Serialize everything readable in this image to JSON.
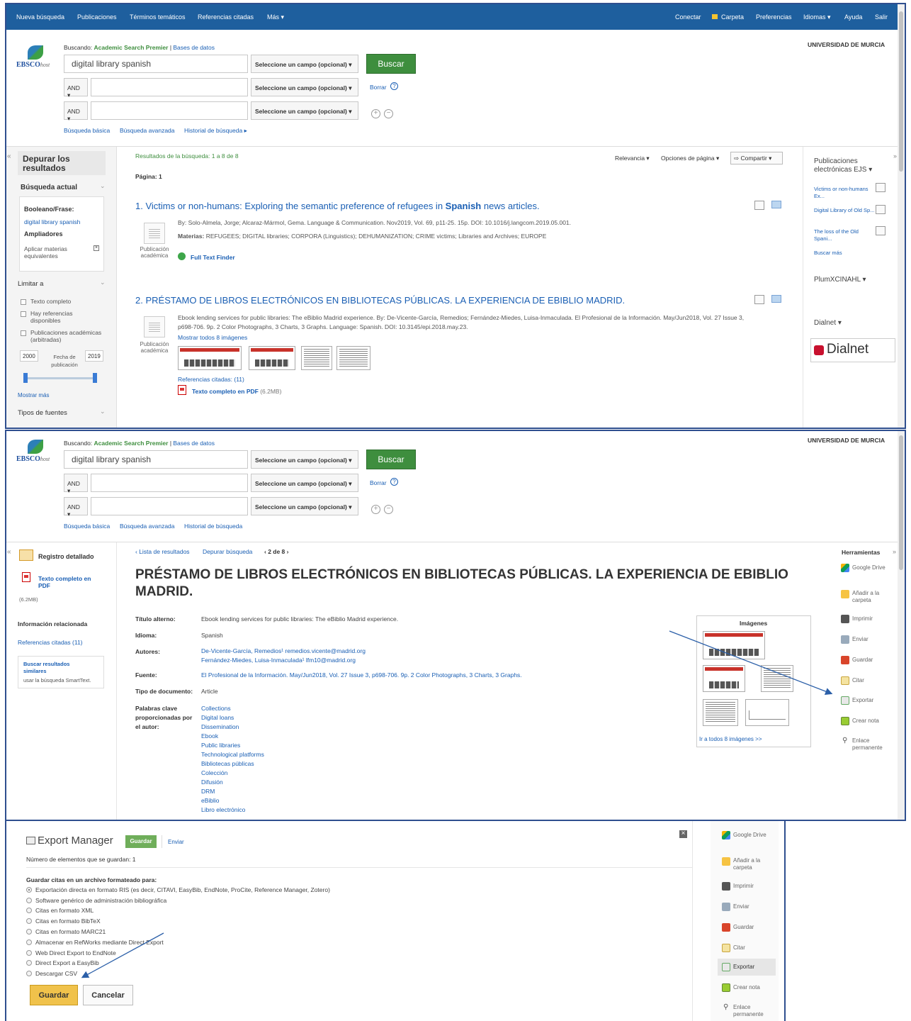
{
  "topnav": {
    "left": [
      "Nueva búsqueda",
      "Publicaciones",
      "Términos temáticos",
      "Referencias citadas",
      "Más ▾"
    ],
    "right": [
      "Conectar",
      "Carpeta",
      "Preferencias",
      "Idiomas ▾",
      "Ayuda",
      "Salir"
    ]
  },
  "header": {
    "institution": "UNIVERSIDAD DE MURCIA",
    "logo_main": "EBSCO",
    "logo_sub": "host",
    "searching_label": "Buscando:",
    "database": "Academic Search Premier",
    "databases_link": "Bases de datos",
    "query": "digital library spanish",
    "field_select": "Seleccione un campo (opcional) ▾",
    "bool_op": "AND ▾",
    "search_button": "Buscar",
    "clear_link": "Borrar",
    "help": "?",
    "add": "+",
    "remove": "−",
    "links": [
      "Búsqueda básica",
      "Búsqueda avanzada",
      "Historial de búsqueda ▸"
    ],
    "links2": [
      "Búsqueda básica",
      "Búsqueda avanzada",
      "Historial de búsqueda"
    ]
  },
  "panel1": {
    "refine_title": "Depurar los resultados",
    "current_search": "Búsqueda actual",
    "boolean_label": "Booleano/Frase:",
    "boolean_value": "digital library spanish",
    "expanders_label": "Ampliadores",
    "expanders_value": "Aplicar materias equivalentes",
    "limit_to": "Limitar a",
    "limit_options": [
      "Texto completo",
      "Hay referencias disponibles",
      "Publicaciones académicas (arbitradas)"
    ],
    "date_from": "2000",
    "date_label": "Fecha de publicación",
    "date_to": "2019",
    "show_more": "Mostrar más",
    "source_types": "Tipos de fuentes",
    "results_label": "Resultados de la búsqueda: 1 a 8 de 8",
    "page_label": "Página: 1",
    "sort": "Relevancia ▾",
    "page_options": "Opciones de página ▾",
    "share": "Compartir ▾",
    "pub_type": "Publicación académica",
    "r1_num": "1.",
    "r1_title_a": "Victims or non-humans: Exploring the semantic preference of refugees in ",
    "r1_title_b": "Spanish",
    "r1_title_c": " news articles.",
    "r1_byline": "By: Solo-Almela, Jorge; Alcaraz-Mármol, Gema. Language & Communication. Nov2019, Vol. 69, p11-25. 15p. DOI: 10.1016/j.langcom.2019.05.001.",
    "r1_subjects_label": "Materias:",
    "r1_subjects": "REFUGEES; DIGITAL libraries; CORPORA (Linguistics); DEHUMANIZATION; CRIME victims; Libraries and Archives; EUROPE",
    "r1_fulltext": "Full Text Finder",
    "r2_num": "2.",
    "r2_title": "PRÉSTAMO DE LIBROS ELECTRÓNICOS EN BIBLIOTECAS PÚBLICAS. LA EXPERIENCIA DE EBIBLIO MADRID.",
    "r2_line1": "Ebook lending services for public libraries: The eBiblio Madrid experience. By: De-Vicente-García, Remedios; Fernández-Miedes, Luisa-Inmaculada. El Profesional de la Información. May/Jun2018, Vol. 27 Issue 3,",
    "r2_line2": "p698-706. 9p. 2 Color Photographs, 3 Charts, 3 Graphs. Language: Spanish. DOI: 10.3145/epi.2018.may.23.",
    "r2_show_images": "Mostrar todos 8 imágenes",
    "r2_cited": "Referencias citadas: (11)",
    "r2_pdf": "Texto completo en PDF",
    "r2_pdf_size": "(6.2MB)",
    "right_pub": "Publicaciones electrónicas EJS ▾",
    "right_items": [
      "Victims or non-humans Ex...",
      "Digital Library of Old Sp...",
      "The loss of the Old Spani..."
    ],
    "right_more": "Buscar más",
    "plum": "PlumXCINAHL ▾",
    "dialnet_label": "Dialnet ▾",
    "dialnet_logo": "Dialnet"
  },
  "panel2": {
    "detail_record": "Registro detallado",
    "fulltext_pdf": "Texto completo en PDF",
    "pdf_size": "(6.2MB)",
    "related_info": "Información relacionada",
    "cited_refs": "Referencias citadas (11)",
    "similar_title": "Buscar resultados similares",
    "similar_sub": "usar la búsqueda SmartText.",
    "nav_results": "‹ Lista de resultados",
    "nav_refine": "Depurar búsqueda",
    "nav_pos": "‹ 2 de 8 ›",
    "title": "PRÉSTAMO DE LIBROS ELECTRÓNICOS EN BIBLIOTECAS PÚBLICAS. LA EXPERIENCIA DE EBIBLIO MADRID.",
    "fields": {
      "alt_title_label": "Título alterno:",
      "alt_title": "Ebook lending services for public libraries: The eBiblio Madrid experience.",
      "lang_label": "Idioma:",
      "lang": "Spanish",
      "authors_label": "Autores:",
      "author1": "De-Vicente-García, Remedios¹ remedios.vicente@madrid.org",
      "author2": "Fernández-Miedes, Luisa-Inmaculada¹ lfm10@madrid.org",
      "source_label": "Fuente:",
      "source": "El Profesional de la Información. May/Jun2018, Vol. 27 Issue 3, p698-706. 9p. 2 Color Photographs, 3 Charts, 3 Graphs.",
      "doctype_label": "Tipo de documento:",
      "doctype": "Article",
      "keywords_label": "Palabras clave proporcionadas por el autor:",
      "keywords": [
        "Collections",
        "Digital loans",
        "Dissemination",
        "Ebook",
        "Public libraries",
        "Technological platforms",
        "Bibliotecas públicas",
        "Colección",
        "Difusión",
        "DRM",
        "eBiblio",
        "Libro electrónico"
      ]
    },
    "images_title": "Imágenes",
    "images_link": "Ir a todos 8 imágenes >>",
    "tools_title": "Herramientas",
    "tools": [
      "Google Drive",
      "Añadir a la carpeta",
      "Imprimir",
      "Enviar",
      "Guardar",
      "Citar",
      "Exportar",
      "Crear nota",
      "Enlace permanente"
    ]
  },
  "panel3": {
    "title": "Export Manager",
    "tab_save": "Guardar",
    "tab_send": "Enviar",
    "count": "Número de elementos que se guardan: 1",
    "format_label": "Guardar citas en un archivo formateado para:",
    "options": [
      "Exportación directa en formato RIS (es decir, CITAVI, EasyBib, EndNote, ProCite, Reference Manager, Zotero)",
      "Software genérico de administración bibliográfica",
      "Citas en formato XML",
      "Citas en formato BibTeX",
      "Citas en formato MARC21",
      "Almacenar en RefWorks mediante Direct Export",
      "Web Direct Export to EndNote",
      "Direct Export a EasyBib",
      "Descargar CSV"
    ],
    "save_button": "Guardar",
    "cancel_button": "Cancelar",
    "close": "×",
    "tools": [
      "Google Drive",
      "Añadir a la carpeta",
      "Imprimir",
      "Enviar",
      "Guardar",
      "Citar",
      "Exportar",
      "Crear nota",
      "Enlace permanente"
    ]
  },
  "colors": {
    "nav": "#1e5f9e",
    "accent_green": "#3e8e3e",
    "annotation_arrow": "#2b5fa8"
  }
}
